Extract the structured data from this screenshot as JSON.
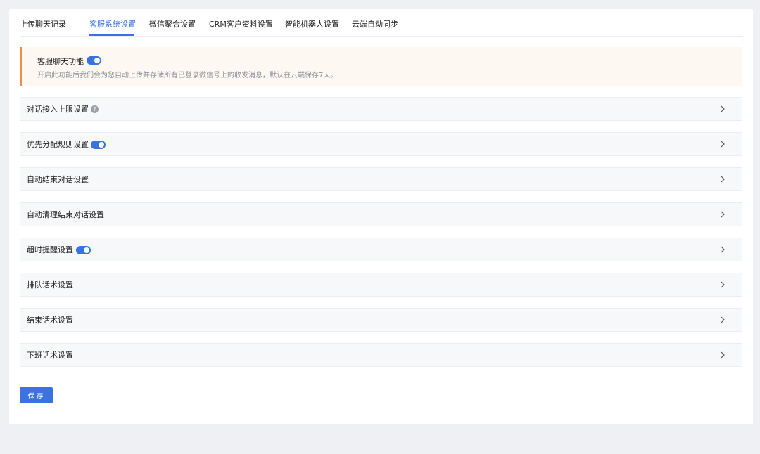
{
  "tabs": [
    {
      "label": "上传聊天记录",
      "active": false
    },
    {
      "label": "客服系统设置",
      "active": true
    },
    {
      "label": "微信聚合设置",
      "active": false
    },
    {
      "label": "CRM客户资料设置",
      "active": false
    },
    {
      "label": "智能机器人设置",
      "active": false
    },
    {
      "label": "云端自动同步",
      "active": false
    }
  ],
  "notice": {
    "title": "客服聊天功能",
    "toggle_on": true,
    "description": "开启此功能后我们会为您自动上传并存储所有已登录微信号上的收发消息，默认在云端保存7天。"
  },
  "panels": [
    {
      "label": "对话接入上限设置",
      "has_help": true,
      "toggle_on": null
    },
    {
      "label": "优先分配规则设置",
      "has_help": false,
      "toggle_on": true
    },
    {
      "label": "自动结束对话设置",
      "has_help": false,
      "toggle_on": null
    },
    {
      "label": "自动清理结束对话设置",
      "has_help": false,
      "toggle_on": null
    },
    {
      "label": "超时提醒设置",
      "has_help": false,
      "toggle_on": true
    },
    {
      "label": "排队话术设置",
      "has_help": false,
      "toggle_on": null
    },
    {
      "label": "结束话术设置",
      "has_help": false,
      "toggle_on": null
    },
    {
      "label": "下班话术设置",
      "has_help": false,
      "toggle_on": null
    }
  ],
  "save_label": "保存",
  "help_glyph": "?",
  "colors": {
    "accent": "#3a72e0",
    "notice_border": "#f08a4b",
    "notice_bg": "#fdf8f1"
  }
}
